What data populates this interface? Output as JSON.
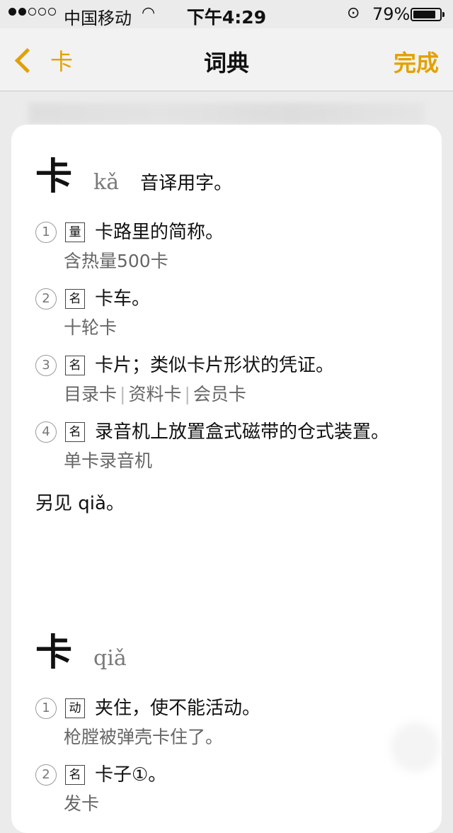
{
  "status_bar": {
    "carrier": "中国移动",
    "time": "下午4:29",
    "battery": "79%",
    "battery_level": 0.79,
    "icons": [
      "signal-dots-icon",
      "wifi-icon",
      "orientation-lock-icon",
      "battery-icon"
    ]
  },
  "nav": {
    "back_label": "卡",
    "title": "词典",
    "done_label": "完成"
  },
  "entries": [
    {
      "char": "卡",
      "pinyin": "kǎ",
      "definition": "音译用字。",
      "senses": [
        {
          "num": "1",
          "pos": "量",
          "def": "卡路里的简称。",
          "examples": [
            "含热量500卡"
          ]
        },
        {
          "num": "2",
          "pos": "名",
          "def": "卡车。",
          "examples": [
            "十轮卡"
          ]
        },
        {
          "num": "3",
          "pos": "名",
          "def": "卡片；类似卡片形状的凭证。",
          "examples": [
            "目录卡",
            "资料卡",
            "会员卡"
          ]
        },
        {
          "num": "4",
          "pos": "名",
          "def": "录音机上放置盒式磁带的仓式装置。",
          "examples": [
            "单卡录音机"
          ]
        }
      ],
      "see_also": "另见 qiǎ。"
    },
    {
      "char": "卡",
      "pinyin": "qiǎ",
      "definition": "",
      "senses": [
        {
          "num": "1",
          "pos": "动",
          "def": "夹住，使不能活动。",
          "examples": [
            "枪膛被弹壳卡住了。"
          ]
        },
        {
          "num": "2",
          "pos": "名",
          "def": "卡子①。",
          "examples": [
            "发卡"
          ]
        }
      ]
    }
  ]
}
